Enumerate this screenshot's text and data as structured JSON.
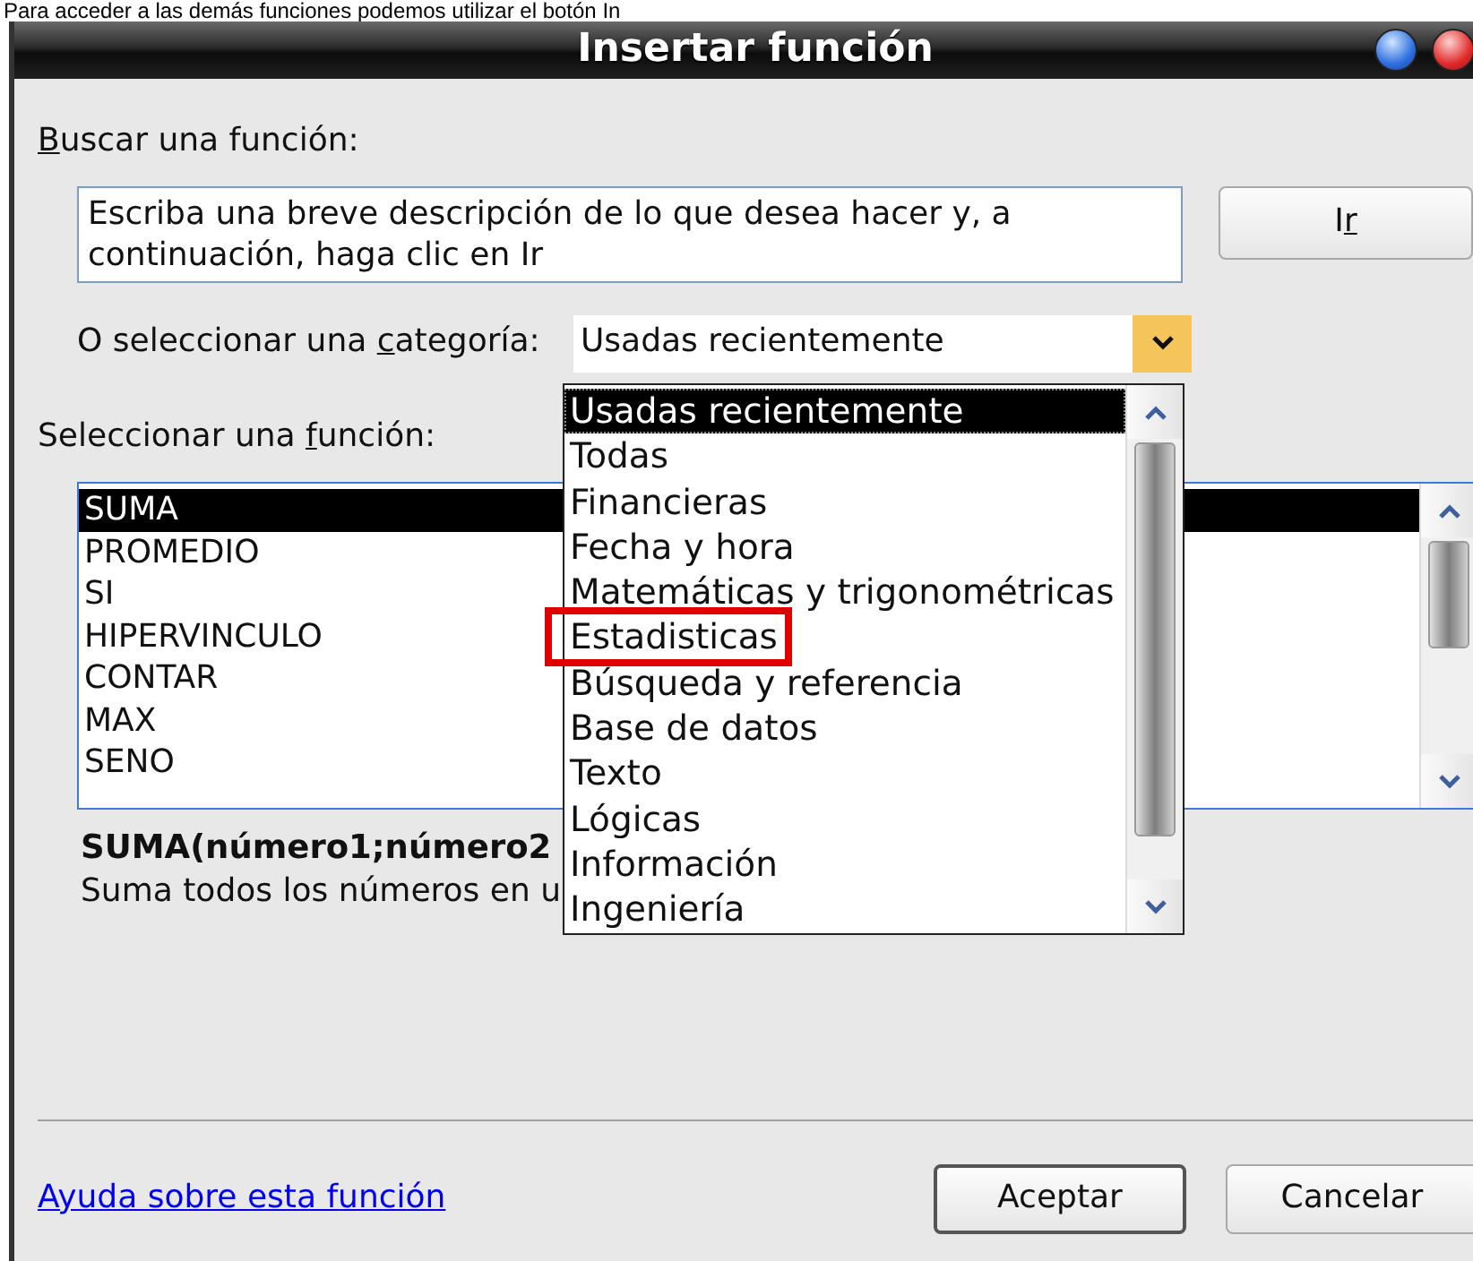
{
  "caption": "Para acceder a las demás funciones podemos utilizar el botón In",
  "window": {
    "title": "Insertar función"
  },
  "search": {
    "label": {
      "key": "B",
      "after": "uscar una función:"
    },
    "value": "Escriba una breve descripción de lo que desea hacer y, a continuación, haga clic en Ir"
  },
  "go_button": {
    "before": "I",
    "key": "r"
  },
  "category": {
    "label": {
      "before": "O seleccionar una ",
      "key": "c",
      "after": "ategoría:"
    },
    "value": "Usadas recientemente",
    "expanded": true,
    "options": [
      {
        "label": "Usadas recientemente",
        "selected": true,
        "annotated": false
      },
      {
        "label": "Todas",
        "selected": false,
        "annotated": false
      },
      {
        "label": "Financieras",
        "selected": false,
        "annotated": false
      },
      {
        "label": "Fecha y hora",
        "selected": false,
        "annotated": false
      },
      {
        "label": "Matemáticas y trigonométricas",
        "selected": false,
        "annotated": false
      },
      {
        "label": "Estadisticas",
        "selected": false,
        "annotated": true
      },
      {
        "label": "Búsqueda y referencia",
        "selected": false,
        "annotated": false
      },
      {
        "label": "Base de datos",
        "selected": false,
        "annotated": false
      },
      {
        "label": "Texto",
        "selected": false,
        "annotated": false
      },
      {
        "label": "Lógicas",
        "selected": false,
        "annotated": false
      },
      {
        "label": "Información",
        "selected": false,
        "annotated": false
      },
      {
        "label": "Ingeniería",
        "selected": false,
        "annotated": false
      }
    ]
  },
  "function_list": {
    "label": {
      "before": "Seleccionar una ",
      "key": "f",
      "after": "unción:"
    },
    "items": [
      {
        "label": "SUMA",
        "selected": true
      },
      {
        "label": "PROMEDIO",
        "selected": false
      },
      {
        "label": "SI",
        "selected": false
      },
      {
        "label": "HIPERVINCULO",
        "selected": false
      },
      {
        "label": "CONTAR",
        "selected": false
      },
      {
        "label": "MAX",
        "selected": false
      },
      {
        "label": "SENO",
        "selected": false
      }
    ]
  },
  "signature": "SUMA(número1;número2",
  "description": "Suma todos los números en u",
  "help_link": "Ayuda sobre esta función",
  "buttons": [
    {
      "label": "Aceptar",
      "default": true
    },
    {
      "label": "Cancelar",
      "default": false
    }
  ]
}
